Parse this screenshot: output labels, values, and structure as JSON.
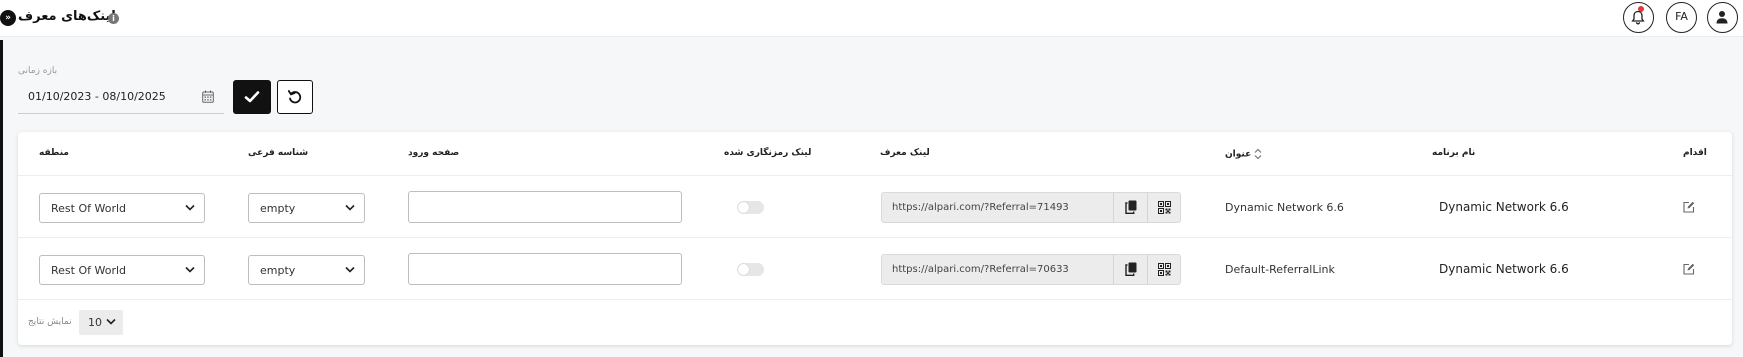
{
  "header": {
    "title": "لینک‌های معرف",
    "language": "FA"
  },
  "filter": {
    "date_label": "بازه زمانی",
    "date_range": "01/10/2023 - 08/10/2025"
  },
  "table": {
    "columns": {
      "action": "اقدام",
      "program_name": "نام برنامه",
      "title": "عنوان",
      "referral_link": "لینک معرف",
      "encrypted_link": "لینک رمزنگاری شده",
      "landing_page": "صفحه ورود",
      "sub_id": "شناسه فرعی",
      "region": "منطقه"
    },
    "rows": [
      {
        "region": "Rest Of World",
        "sub_id": "empty",
        "landing_page": "",
        "encrypted": false,
        "referral_link": "https://alpari.com/?Referral=71493",
        "title": "Dynamic Network 6.6",
        "program_name": "Dynamic Network 6.6"
      },
      {
        "region": "Rest Of World",
        "sub_id": "empty",
        "landing_page": "",
        "encrypted": false,
        "referral_link": "https://alpari.com/?Referral=70633",
        "title": "Default-ReferralLink",
        "program_name": "Dynamic Network 6.6"
      }
    ]
  },
  "pagination": {
    "rows_label": "نمایش نتایج",
    "page_size": "10"
  },
  "colors": {
    "accent": "#111111",
    "notification_dot": "#e53935",
    "link_box_bg": "#ececec"
  }
}
